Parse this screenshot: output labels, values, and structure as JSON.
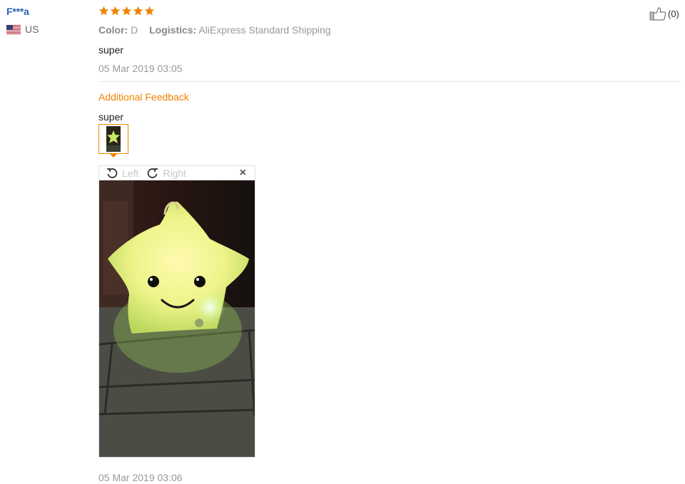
{
  "review": {
    "user": {
      "name": "F***a",
      "country": "US",
      "flag_icon": "us-flag-icon"
    },
    "rating": 5,
    "star_color": "#f08200",
    "meta": {
      "color_label": "Color:",
      "color_value": "D",
      "logistics_label": "Logistics:",
      "logistics_value": "AliExpress Standard Shipping"
    },
    "text": "super",
    "date": "05 Mar 2019 03:05",
    "additional": {
      "title": "Additional Feedback",
      "text": "super",
      "date": "05 Mar 2019 03:06"
    },
    "viewer": {
      "rotate_left_label": "Left",
      "rotate_right_label": "Right",
      "close_glyph": "×"
    },
    "helpful": {
      "icon": "thumbs-up-icon",
      "count": "(0)"
    }
  }
}
